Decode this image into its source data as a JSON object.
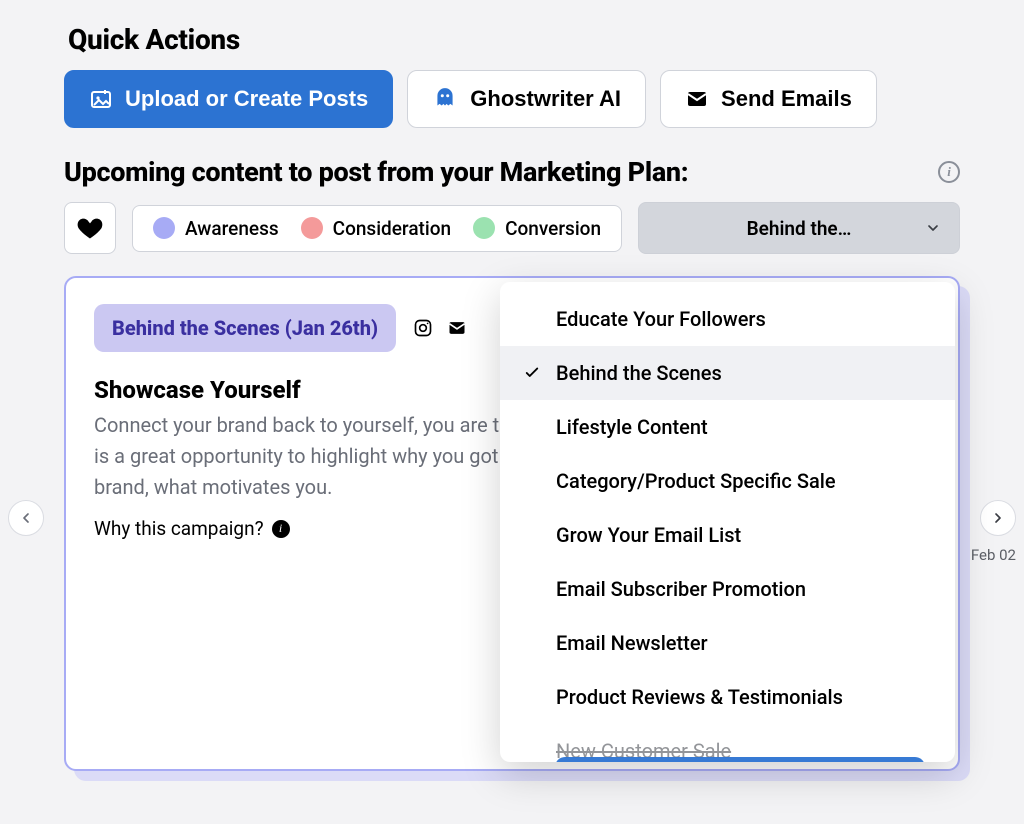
{
  "colors": {
    "primary": "#2C73D2",
    "awareness": "#A7ABF5",
    "consideration": "#F49A9A",
    "conversion": "#9BE2B0"
  },
  "quick_actions": {
    "title": "Quick Actions",
    "buttons": [
      {
        "label": "Upload or Create Posts",
        "icon": "image-plus-icon",
        "primary": true
      },
      {
        "label": "Ghostwriter AI",
        "icon": "ghost-icon",
        "primary": false
      },
      {
        "label": "Send Emails",
        "icon": "envelope-icon",
        "primary": false
      }
    ]
  },
  "section": {
    "heading": "Upcoming content to post from your Marketing Plan:"
  },
  "legend": {
    "items": [
      {
        "label": "Awareness",
        "color": "#A7ABF5"
      },
      {
        "label": "Consideration",
        "color": "#F49A9A"
      },
      {
        "label": "Conversion",
        "color": "#9BE2B0"
      }
    ]
  },
  "selector": {
    "display": "Behind the…",
    "options": [
      "Educate Your Followers",
      "Behind the Scenes",
      "Lifestyle Content",
      "Category/Product Specific Sale",
      "Grow Your Email List",
      "Email Subscriber Promotion",
      "Email Newsletter",
      "Product Reviews & Testimonials"
    ],
    "partial_next": "New Customer Sale",
    "selected_index": 1
  },
  "card": {
    "tag": "Behind the Scenes (Jan 26th)",
    "channels": [
      "instagram",
      "email"
    ],
    "title": "Showcase Yourself",
    "body": "Connect your brand back to yourself, you are the brains of the brand after all! This is a great opportunity to highlight why you got started, fun facts about yourself & brand, what motivates you.",
    "why_label": "Why this campaign?"
  },
  "carousel": {
    "next_date_label": "Feb 02"
  }
}
